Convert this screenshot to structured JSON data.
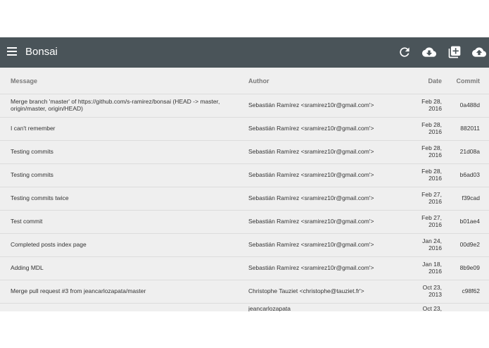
{
  "app": {
    "title": "Bonsai"
  },
  "toolbar": {
    "menu_icon": "menu-icon",
    "refresh_icon": "refresh-icon",
    "download_icon": "cloud-download-icon",
    "add_icon": "add-box-icon",
    "upload_icon": "cloud-upload-icon"
  },
  "table": {
    "headers": {
      "message": "Message",
      "author": "Author",
      "date": "Date",
      "commit": "Commit"
    },
    "rows": [
      {
        "message": "Merge branch 'master' of https://github.com/s-ramirez/bonsai (HEAD -> master, origin/master, origin/HEAD)",
        "author": "Sebastián Ramírez <sramirez10r@gmail.com'>",
        "date_md": "Feb 28,",
        "date_y": "2016",
        "commit": "0a488d"
      },
      {
        "message": "I can't remember",
        "author": "Sebastián Ramírez <sramirez10r@gmail.com'>",
        "date_md": "Feb 28,",
        "date_y": "2016",
        "commit": "882011"
      },
      {
        "message": "Testing commits",
        "author": "Sebastián Ramírez <sramirez10r@gmail.com'>",
        "date_md": "Feb 28,",
        "date_y": "2016",
        "commit": "21d08a"
      },
      {
        "message": "Testing commits",
        "author": "Sebastián Ramírez <sramirez10r@gmail.com'>",
        "date_md": "Feb 28,",
        "date_y": "2016",
        "commit": "b6ad03"
      },
      {
        "message": "Testing commits twice",
        "author": "Sebastián Ramírez <sramirez10r@gmail.com'>",
        "date_md": "Feb 27,",
        "date_y": "2016",
        "commit": "f39cad"
      },
      {
        "message": "Test commit",
        "author": "Sebastián Ramírez <sramirez10r@gmail.com'>",
        "date_md": "Feb 27,",
        "date_y": "2016",
        "commit": "b01ae4"
      },
      {
        "message": "Completed posts index page",
        "author": "Sebastián Ramírez <sramirez10r@gmail.com'>",
        "date_md": "Jan 24,",
        "date_y": "2016",
        "commit": "00d9e2"
      },
      {
        "message": "Adding MDL",
        "author": "Sebastián Ramírez <sramirez10r@gmail.com'>",
        "date_md": "Jan 18,",
        "date_y": "2016",
        "commit": "8b9e09"
      },
      {
        "message": "Merge pull request #3 from jeancarlozapata/master",
        "author": "Christophe Tauziet <christophe@tauziet.fr'>",
        "date_md": "Oct 23,",
        "date_y": "2013",
        "commit": "c98f62"
      },
      {
        "message": "",
        "author": "jeancarlozapata",
        "date_md": "Oct 23,",
        "date_y": "",
        "commit": ""
      }
    ]
  }
}
